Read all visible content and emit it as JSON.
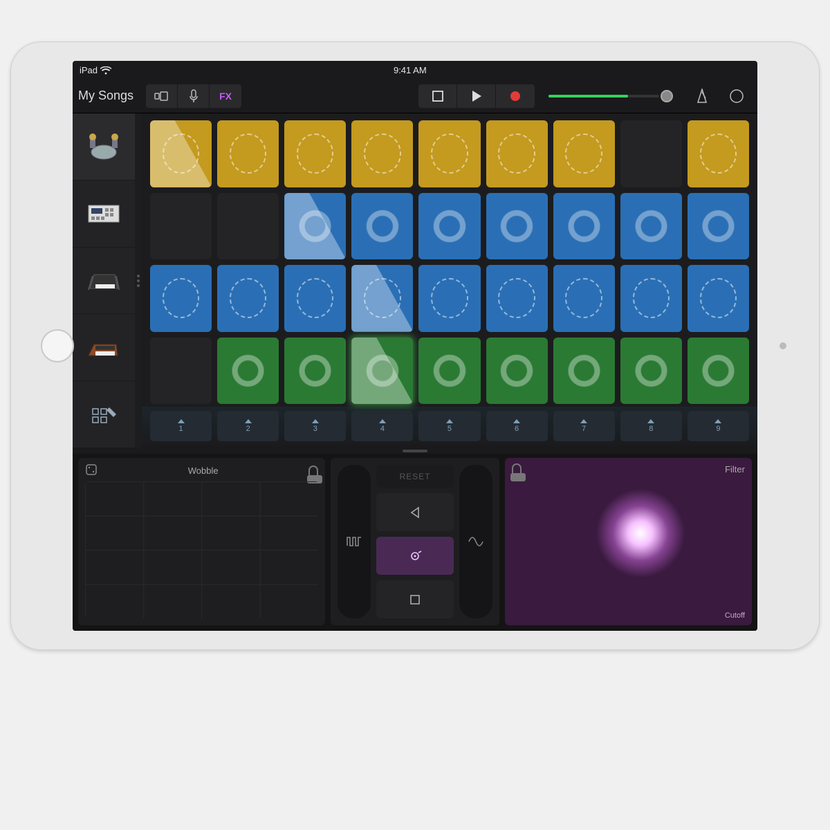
{
  "status": {
    "device": "iPad",
    "time": "9:41 AM"
  },
  "toolbar": {
    "back_label": "My Songs",
    "fx_label": "FX"
  },
  "volume": {
    "level_pct": 72
  },
  "instruments": [
    {
      "name": "drums"
    },
    {
      "name": "sampler"
    },
    {
      "name": "keyboard"
    },
    {
      "name": "synth"
    },
    {
      "name": "edit"
    }
  ],
  "grid": {
    "columns": 9,
    "rows": [
      {
        "color": "yellow",
        "cells": [
          "playing",
          "on",
          "on",
          "on",
          "on",
          "on",
          "on",
          "empty",
          "on"
        ]
      },
      {
        "color": "blue",
        "cells": [
          "empty",
          "empty",
          "playing",
          "on",
          "on",
          "on",
          "on",
          "on",
          "on"
        ]
      },
      {
        "color": "blue",
        "cells": [
          "on",
          "on",
          "on",
          "playing",
          "on",
          "on",
          "on",
          "on",
          "on"
        ]
      },
      {
        "color": "green",
        "cells": [
          "empty",
          "on",
          "on",
          "playing-glow",
          "on",
          "on",
          "on",
          "on",
          "on"
        ]
      }
    ]
  },
  "triggers": [
    "1",
    "2",
    "3",
    "4",
    "5",
    "6",
    "7",
    "8",
    "9"
  ],
  "fx": {
    "left_label": "Wobble",
    "right_label": "Filter",
    "right_corner": "Cutoff",
    "reset_label": "RESET"
  }
}
